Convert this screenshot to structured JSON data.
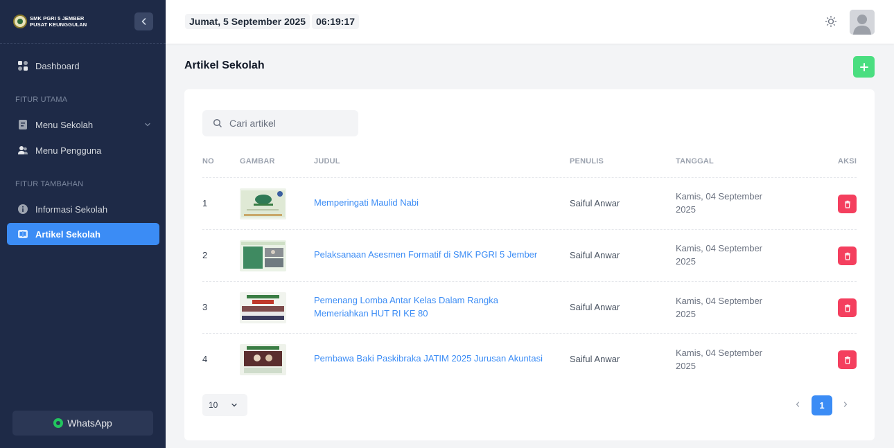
{
  "brand": {
    "line1": "SMK PGRI 5 JEMBER",
    "line2": "PUSAT KEUNGGULAN"
  },
  "sidebar": {
    "dashboard": "Dashboard",
    "section_main": "FITUR UTAMA",
    "menu_sekolah": "Menu Sekolah",
    "menu_pengguna": "Menu Pengguna",
    "section_extra": "FITUR TAMBAHAN",
    "informasi_sekolah": "Informasi Sekolah",
    "artikel_sekolah": "Artikel Sekolah",
    "whatsapp": "WhatsApp"
  },
  "header": {
    "date": "Jumat, 5 September 2025",
    "time": "06:19:17"
  },
  "page": {
    "title": "Artikel Sekolah"
  },
  "search": {
    "placeholder": "Cari artikel"
  },
  "table": {
    "columns": [
      "NO",
      "GAMBAR",
      "JUDUL",
      "PENULIS",
      "TANGGAL",
      "AKSI"
    ],
    "rows": [
      {
        "no": "1",
        "title_line1": "Memperingati Maulid Nabi",
        "title_line2": "",
        "author": "Saiful Anwar",
        "date_line1": "Kamis, 04 September",
        "date_line2": "2025"
      },
      {
        "no": "2",
        "title_line1": "Pelaksanaan Asesmen Formatif di SMK PGRI 5 Jember",
        "title_line2": "",
        "author": "Saiful Anwar",
        "date_line1": "Kamis, 04 September",
        "date_line2": "2025"
      },
      {
        "no": "3",
        "title_line1": "Pemenang Lomba Antar Kelas Dalam Rangka",
        "title_line2": "Memeriahkan HUT RI KE 80",
        "author": "Saiful Anwar",
        "date_line1": "Kamis, 04 September",
        "date_line2": "2025"
      },
      {
        "no": "4",
        "title_line1": "Pembawa Baki Paskibraka JATIM 2025 Jurusan Akuntasi",
        "title_line2": "",
        "author": "Saiful Anwar",
        "date_line1": "Kamis, 04 September",
        "date_line2": "2025"
      }
    ]
  },
  "pagination": {
    "page_size": "10",
    "current_page": "1"
  },
  "colors": {
    "sidebar_bg": "#1e2a47",
    "accent": "#3b8cf5",
    "add": "#4ade80",
    "delete": "#f43f5e"
  },
  "icons": [
    "dashboard-icon",
    "menu-sekolah-icon",
    "users-icon",
    "info-icon",
    "book-icon",
    "whatsapp-icon",
    "sun-icon",
    "avatar-icon",
    "plus-icon",
    "search-icon",
    "trash-icon",
    "chevron-down-icon",
    "chevron-left-icon",
    "chevron-right-icon"
  ]
}
